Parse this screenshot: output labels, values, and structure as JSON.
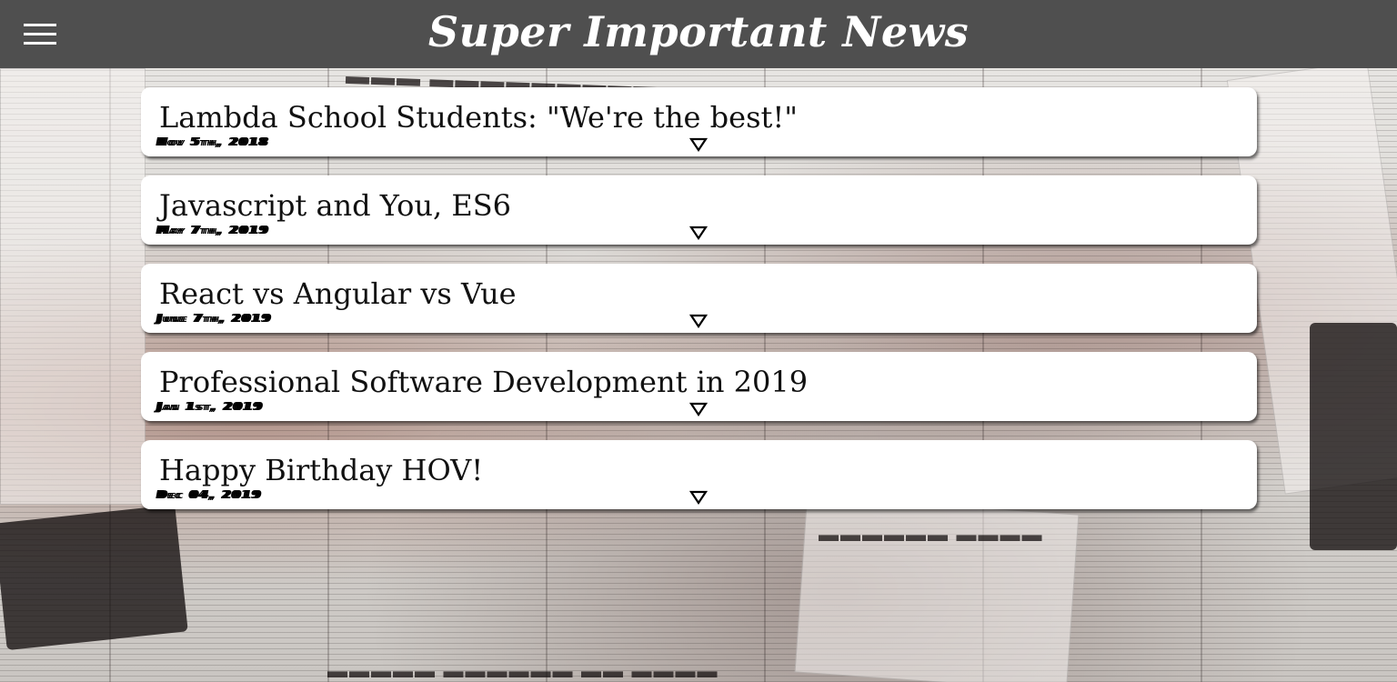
{
  "header": {
    "title": "Super Important News"
  },
  "articles": [
    {
      "title": "Lambda School Students: \"We're the best!\"",
      "date": "Nov 5th, 2018"
    },
    {
      "title": "Javascript and You, ES6",
      "date": "May 7th, 2019"
    },
    {
      "title": "React vs Angular vs Vue",
      "date": "June 7th, 2019"
    },
    {
      "title": "Professional Software Development in 2019",
      "date": "Jan 1st, 2019"
    },
    {
      "title": "Happy Birthday HOV!",
      "date": "Dec 04, 2019"
    }
  ],
  "icons": {
    "menu": "hamburger-menu-icon",
    "expand": "down-triangle-icon"
  },
  "colors": {
    "header_bg": "#4f4f4f",
    "card_bg": "#ffffff"
  }
}
